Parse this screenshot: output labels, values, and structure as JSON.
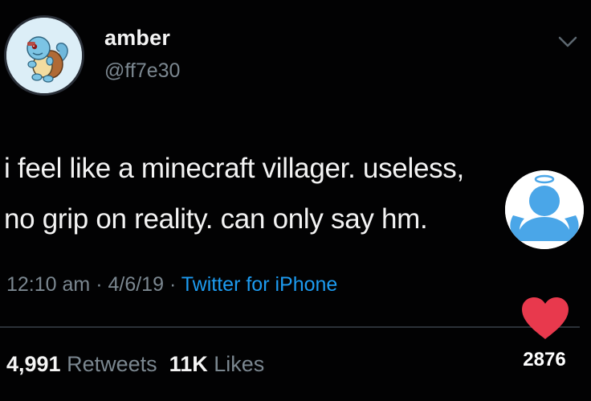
{
  "user": {
    "display_name": "amber",
    "handle": "@ff7e30",
    "avatar_icon": "squirtle-avatar-icon"
  },
  "tweet": {
    "line1": "i feel like a minecraft villager. useless,",
    "line2": "no grip on reality. can only say hm."
  },
  "meta": {
    "time": "12:10 am",
    "date": "4/6/19",
    "sep": "·",
    "source": "Twitter for iPhone"
  },
  "stats": {
    "retweets": "4,991",
    "retweets_label": "Retweets",
    "likes": "11K",
    "likes_label": "Likes"
  },
  "overlay": {
    "avatar_icon": "angel-default-avatar-icon",
    "heart_icon": "heart-icon",
    "like_count": "2876"
  },
  "colors": {
    "background": "#020203",
    "text": "#f3f3f3",
    "muted": "#7b8790",
    "link": "#1d9bf0",
    "heart": "#e8394d",
    "overlay_avatar": "#4aa6e8"
  }
}
